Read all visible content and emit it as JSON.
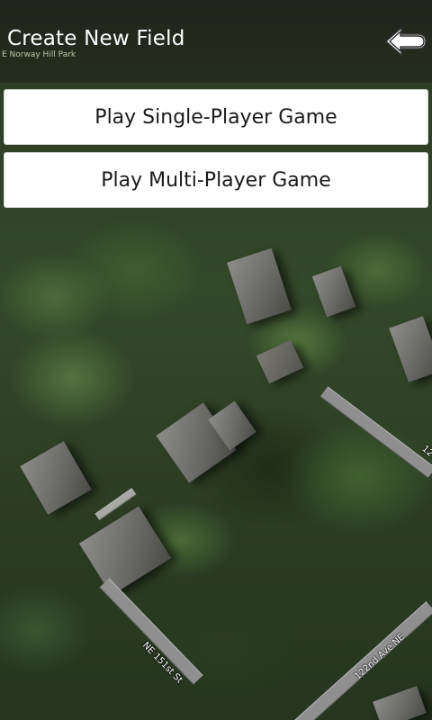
{
  "header": {
    "title": "Create New Field",
    "back_icon": "back-arrow-icon"
  },
  "map": {
    "park_label": "E Norway Hill Park",
    "road_labels": [
      "NE 151st St",
      "122nd Ave NE",
      "12"
    ]
  },
  "menu": {
    "single_player_label": "Play Single-Player Game",
    "multi_player_label": "Play Multi-Player Game"
  }
}
